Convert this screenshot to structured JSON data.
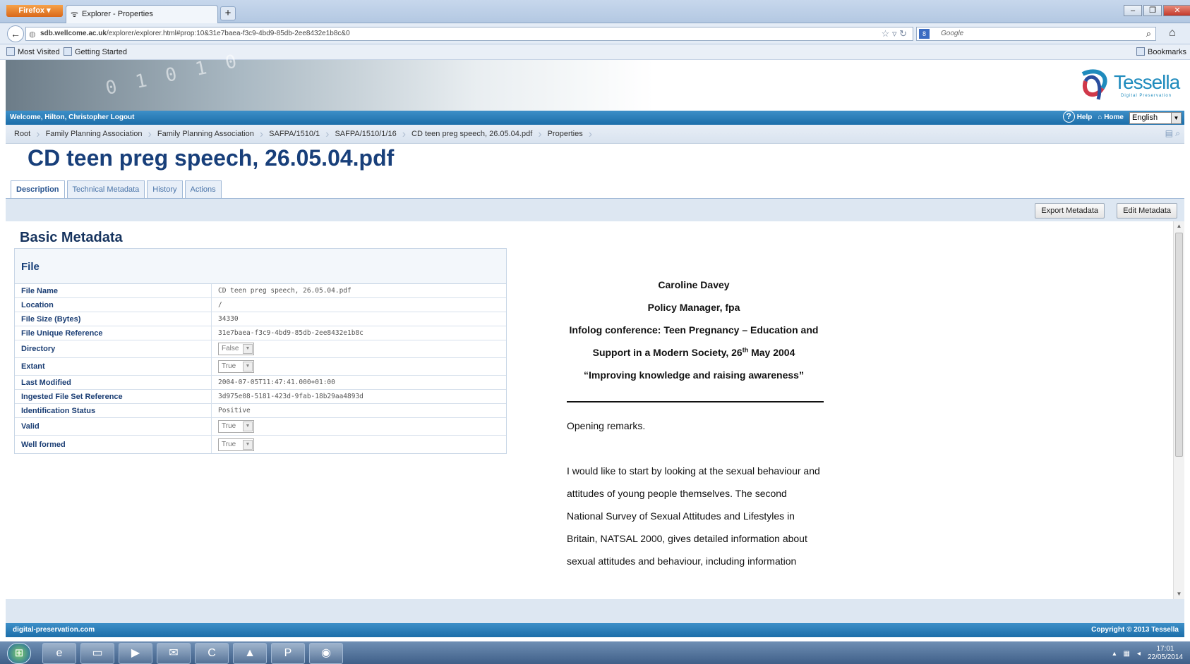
{
  "browser": {
    "app_button": "Firefox",
    "tab_title": "Explorer - Properties",
    "url_host": "sdb.wellcome.ac.uk",
    "url_path": "/explorer/explorer.html#prop:10&31e7baea-f3c9-4bd9-85db-2ee8432e1b8c&0",
    "search_placeholder": "Google",
    "search_engine_icon": "google-icon",
    "bookmarks": [
      "Most Visited",
      "Getting Started"
    ],
    "bookmarks_menu": "Bookmarks"
  },
  "app": {
    "logo_text": "Tessella",
    "logo_sub": "Digital Preservation",
    "welcome": "Welcome, Hilton, Christopher",
    "logout": "Logout",
    "help": "Help",
    "home": "Home",
    "language": "English"
  },
  "breadcrumbs": [
    "Root",
    "Family Planning Association",
    "Family Planning Association",
    "SAFPA/1510/1",
    "SAFPA/1510/1/16",
    "CD teen preg speech, 26.05.04.pdf",
    "Properties"
  ],
  "page_title": "CD teen preg speech, 26.05.04.pdf",
  "tabs": [
    "Description",
    "Technical Metadata",
    "History",
    "Actions"
  ],
  "toolbar": {
    "export": "Export Metadata",
    "edit": "Edit Metadata"
  },
  "metadata": {
    "section_title": "Basic Metadata",
    "group_title": "File",
    "rows": [
      {
        "key": "File Name",
        "value": "CD teen preg speech, 26.05.04.pdf"
      },
      {
        "key": "Location",
        "value": "/"
      },
      {
        "key": "File Size (Bytes)",
        "value": "34330"
      },
      {
        "key": "File Unique Reference",
        "value": "31e7baea-f3c9-4bd9-85db-2ee8432e1b8c"
      },
      {
        "key": "Directory",
        "value": "False"
      },
      {
        "key": "Extant",
        "value": "True"
      },
      {
        "key": "Last Modified",
        "value": "2004-07-05T11:47:41.000+01:00"
      },
      {
        "key": "Ingested File Set Reference",
        "value": "3d975e08-5181-423d-9fab-18b29aa4893d"
      },
      {
        "key": "Identification Status",
        "value": "Positive"
      },
      {
        "key": "Valid",
        "value": "True"
      },
      {
        "key": "Well formed",
        "value": "True"
      }
    ]
  },
  "preview": {
    "author": "Caroline Davey",
    "role": "Policy Manager, fpa",
    "conf_line1": "Infolog conference: Teen Pregnancy – Education and",
    "conf_line2_a": "Support in a Modern Society, 26",
    "conf_line2_sup": "th",
    "conf_line2_b": " May 2004",
    "quote": "“Improving knowledge and raising awareness”",
    "opening": "Opening remarks.",
    "para": [
      "I would like to start by looking at the sexual behaviour and",
      "attitudes of young people themselves. The second",
      "National Survey of Sexual Attitudes and Lifestyles in",
      "Britain, NATSAL 2000, gives detailed information about",
      "sexual attitudes and behaviour, including information"
    ]
  },
  "footer": {
    "left": "digital-preservation.com",
    "right": "Copyright © 2013 Tessella"
  },
  "taskbar": {
    "time": "17:01",
    "date": "22/05/2014"
  }
}
